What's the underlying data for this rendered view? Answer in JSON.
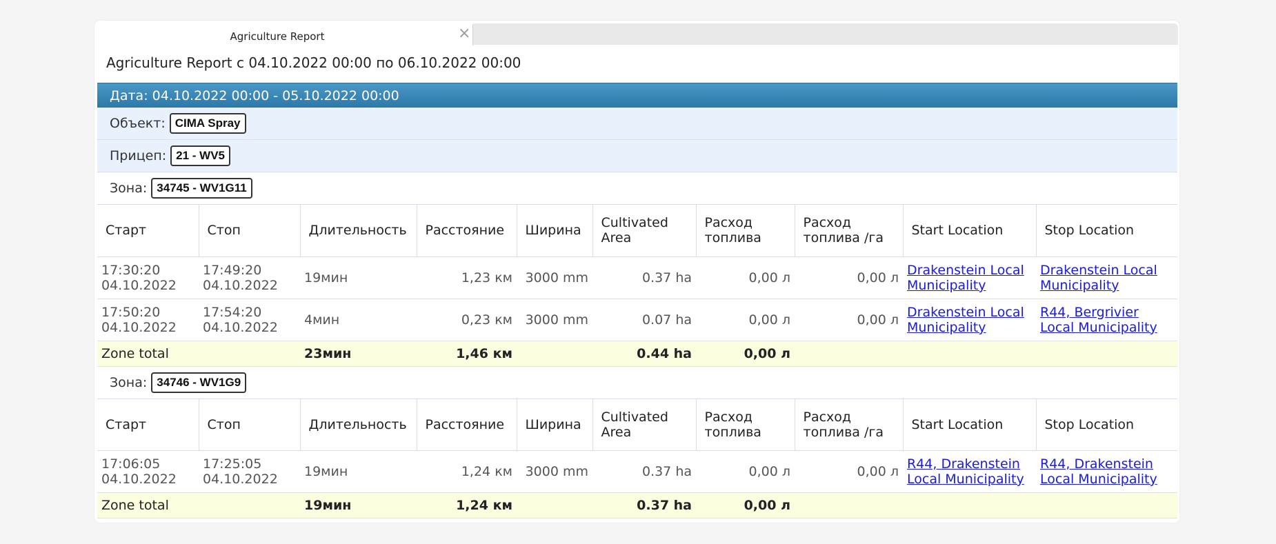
{
  "tab": {
    "title": "Agriculture Report",
    "close": "×"
  },
  "report_title": "Agriculture Report с 04.10.2022 00:00 по 06.10.2022 00:00",
  "date_bar": "Дата: 04.10.2022 00:00 - 05.10.2022 00:00",
  "object": {
    "label": "Объект:",
    "value": "CIMA Spray"
  },
  "trailer": {
    "label": "Прицеп:",
    "value": "21 - WV5"
  },
  "columns": [
    "Старт",
    "Стоп",
    "Длительность",
    "Расстояние",
    "Ширина",
    "Cultivated Area",
    "Расход топлива",
    "Расход топлива /га",
    "Start Location",
    "Stop Location"
  ],
  "zones": [
    {
      "label": "Зона:",
      "value": "34745 - WV1G11",
      "rows": [
        {
          "start_time": "17:30:20",
          "start_date": "04.10.2022",
          "stop_time": "17:49:20",
          "stop_date": "04.10.2022",
          "duration": "19мин",
          "distance": "1,23 км",
          "width": "3000 mm",
          "area": "0.37 ha",
          "fuel": "0,00 л",
          "fuel_ha": "0,00 л",
          "start_loc": "Drakenstein Local Municipality",
          "stop_loc": "Drakenstein Local Municipality"
        },
        {
          "start_time": "17:50:20",
          "start_date": "04.10.2022",
          "stop_time": "17:54:20",
          "stop_date": "04.10.2022",
          "duration": "4мин",
          "distance": "0,23 км",
          "width": "3000 mm",
          "area": "0.07 ha",
          "fuel": "0,00 л",
          "fuel_ha": "0,00 л",
          "start_loc": "Drakenstein Local Municipality",
          "stop_loc": "R44, Bergrivier Local Municipality"
        }
      ],
      "total": {
        "label": "Zone total",
        "duration": "23мин",
        "distance": "1,46 км",
        "area": "0.44 ha",
        "fuel": "0,00 л"
      }
    },
    {
      "label": "Зона:",
      "value": "34746 - WV1G9",
      "rows": [
        {
          "start_time": "17:06:05",
          "start_date": "04.10.2022",
          "stop_time": "17:25:05",
          "stop_date": "04.10.2022",
          "duration": "19мин",
          "distance": "1,24 км",
          "width": "3000 mm",
          "area": "0.37 ha",
          "fuel": "0,00 л",
          "fuel_ha": "0,00 л",
          "start_loc": "R44, Drakenstein Local Municipality",
          "stop_loc": "R44, Drakenstein Local Municipality"
        }
      ],
      "total": {
        "label": "Zone total",
        "duration": "19мин",
        "distance": "1,24 км",
        "area": "0.37 ha",
        "fuel": "0,00 л"
      }
    }
  ]
}
